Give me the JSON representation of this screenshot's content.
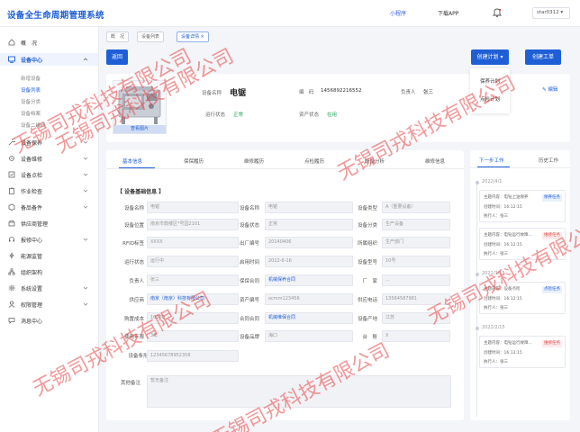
{
  "header": {
    "title": "设备全生命周期管理系统",
    "mini_program": "小程序",
    "download_app": "下载APP",
    "user": "star0312"
  },
  "sidebar": {
    "overview": "概　况",
    "device_center": "设备中心",
    "device_center_subs": [
      "新增设备",
      "设备列表",
      "设备分类",
      "设备档案",
      "设备二维码"
    ],
    "items": [
      "设备保养",
      "设备维修",
      "设备点检",
      "作业检查",
      "备品备件",
      "供应商管理",
      "报修中心",
      "能源监管",
      "组织架构",
      "系统设置",
      "权限管理",
      "消息中心"
    ]
  },
  "breadcrumb": [
    "概　况",
    "设备列表",
    "设备详情"
  ],
  "toolbar": {
    "back": "返回",
    "create_plan": "创建计划",
    "create_order": "创建工单",
    "plan_menu": [
      "保养计划",
      "点检计划"
    ]
  },
  "device": {
    "image_caption": "查看图片",
    "name_label": "设备名称",
    "name": "电锯",
    "code_label": "编　码",
    "code": "1456892216552",
    "owner_label": "负责人",
    "owner": "张三",
    "run_status_label": "运行状态",
    "run_status": "正常",
    "asset_status_label": "资产状态",
    "asset_status": "在用",
    "edit": "编辑"
  },
  "tabs": [
    "基本信息",
    "保保履历",
    "维修履历",
    "点检履历",
    "设备分析",
    "维修信息"
  ],
  "basic": {
    "section_title": "【 设备基础信息 】",
    "rows": [
      [
        [
          "设备名称",
          "电锯"
        ],
        [
          "设备名称",
          "电锯"
        ],
        [
          "设备类型",
          "A（重要设备）"
        ]
      ],
      [
        [
          "设备位置",
          "南京市鼓楼区*号园2101"
        ],
        [
          "设备状态",
          "正常"
        ],
        [
          "设备分类",
          "生产设备"
        ]
      ],
      [
        [
          "RFID标签",
          "XXXX"
        ],
        [
          "出厂编号",
          "20140406"
        ],
        [
          "所属组织",
          "生产部门"
        ]
      ],
      [
        [
          "运行状态",
          "运行中"
        ],
        [
          "启用时间",
          "2022-6-16"
        ],
        [
          "设备型号",
          "10号"
        ]
      ],
      [
        [
          "负责人",
          "张三"
        ],
        [
          "保保合同",
          "机械保养合同"
        ],
        [
          "厂　家",
          "..."
        ]
      ],
      [
        [
          "供应商",
          "南京（南京）科技有限公司"
        ],
        [
          "资产编号",
          "ocmm123456"
        ],
        [
          "供应电话",
          "13584587981"
        ]
      ],
      [
        [
          "购置成本",
          "10000"
        ],
        [
          "合同合同",
          "机械维保合同"
        ],
        [
          "设备产地",
          "江苏"
        ]
      ],
      [
        [
          "使用年限",
          "3年"
        ],
        [
          "设备品牌",
          "海口"
        ],
        [
          "台　账",
          "X"
        ]
      ]
    ],
    "qr_label": "设备条形码",
    "qr_value": "12345678952358",
    "remark_label": "其他备注",
    "remark_placeholder": "暂无备注"
  },
  "side": {
    "tab_todo": "下一步工作",
    "tab_history": "历史工作",
    "groups": [
      {
        "date": "2022/4/1",
        "cards": [
          {
            "title": "主题内容：电钻上油保养",
            "time": "创建时间：16:12:15",
            "person": "执行人：张三",
            "badge": "保养任务",
            "kind": "blue"
          },
          {
            "title": "主题内容：电钻运行故障...",
            "time": "创建时间：16:12:15",
            "person": "执行人：张三",
            "badge": "维修任务",
            "kind": "red"
          }
        ]
      },
      {
        "date": "2022/3/15",
        "cards": [
          {
            "title": "主题内容：设备点检",
            "time": "创建时间：16:12:15",
            "person": "执行人：张三",
            "badge": "点检任务",
            "kind": "blue"
          }
        ]
      },
      {
        "date": "2022/2/15",
        "cards": [
          {
            "title": "主题内容：电钻运行故障...",
            "time": "创建时间：16:12:15",
            "person": "执行人：张三",
            "badge": "维修任务",
            "kind": "red"
          }
        ]
      }
    ]
  },
  "watermark": "无锡司戎科技有限公司",
  "colors": {
    "accent": "#1f5fd6",
    "green": "#22a35a",
    "red": "#e04848",
    "watermark": "#e64646"
  }
}
